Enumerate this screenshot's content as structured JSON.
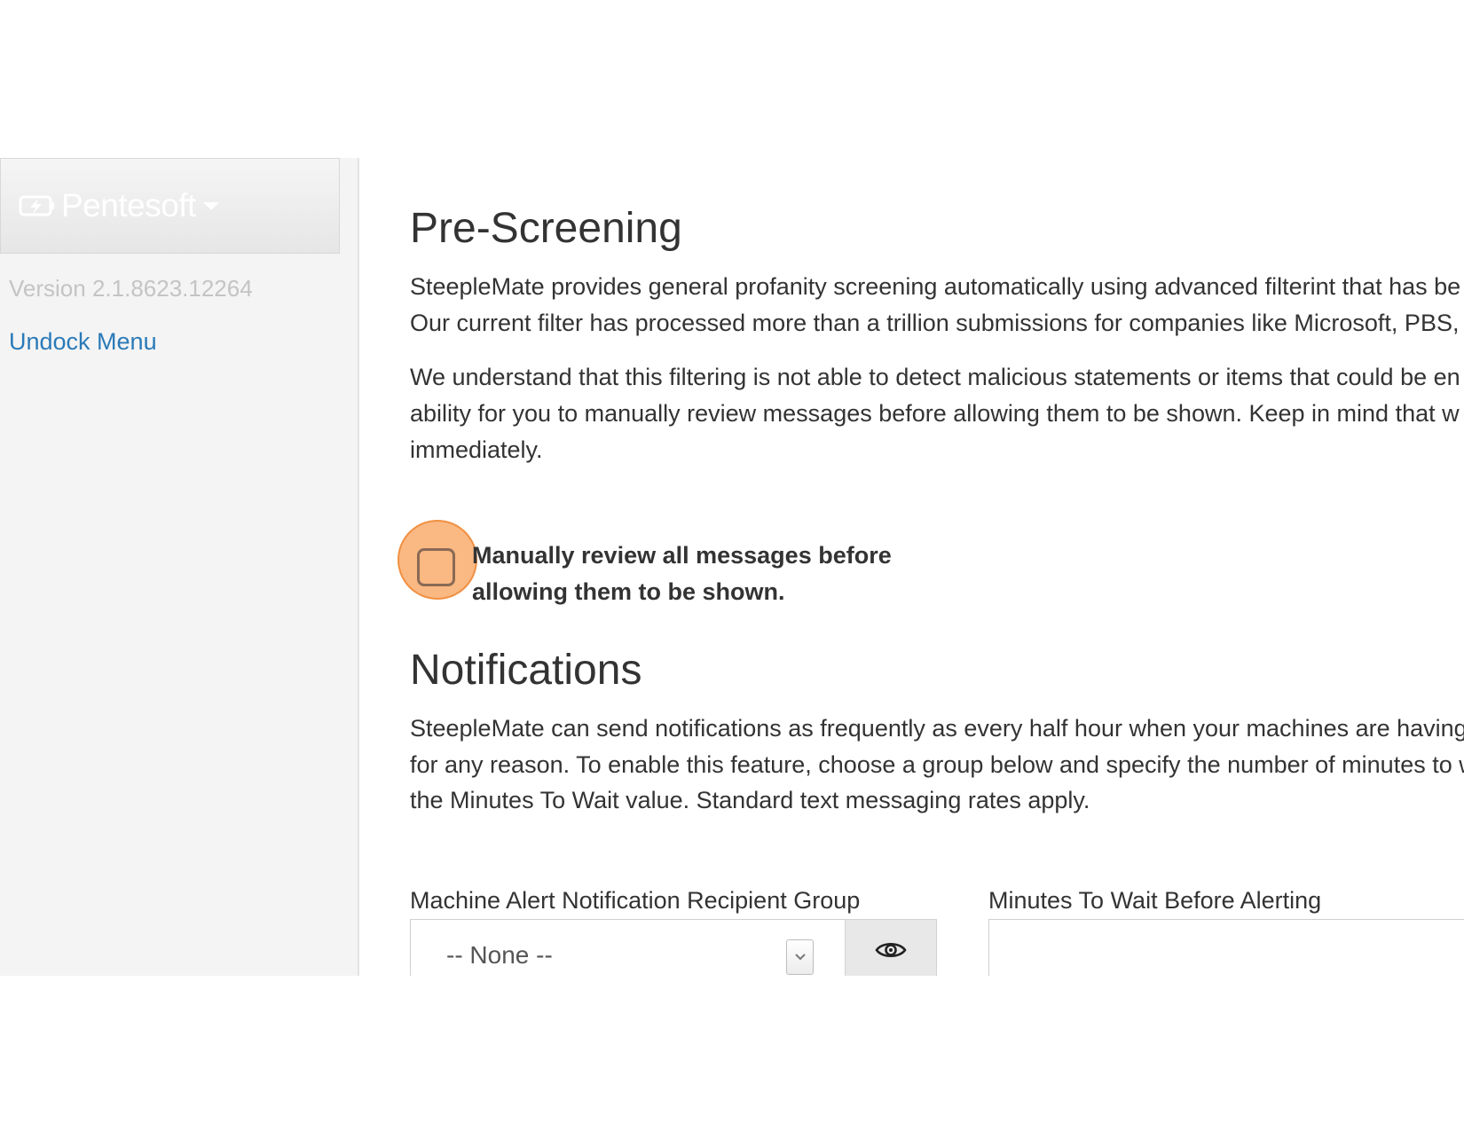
{
  "sidebar": {
    "brand_name": "Pentesoft",
    "version": "Version 2.1.8623.12264",
    "undock_label": "Undock Menu"
  },
  "prescreening": {
    "title": "Pre-Screening",
    "p1_line1": "SteepleMate provides general profanity screening automatically using advanced filterint that has be",
    "p1_line2": "Our current filter has processed more than a trillion submissions for companies like Microsoft, PBS, I",
    "p2_line1": "We understand that this filtering is not able to detect malicious statements or items that could be en",
    "p2_line2": "ability for you to manually review messages before allowing them to be shown. Keep in mind that w",
    "p2_line3": "immediately.",
    "checkbox_line1": "Manually review all messages before",
    "checkbox_line2": "allowing them to be shown.",
    "checkbox_checked": false
  },
  "notifications": {
    "title": "Notifications",
    "p_line1": "SteepleMate can send notifications as frequently as every half hour when your machines are having",
    "p_line2": "for any reason. To enable this feature, choose a group below and specify the number of minutes to w",
    "p_line3": "the Minutes To Wait value. Standard text messaging rates apply.",
    "group_label": "Machine Alert Notification Recipient Group",
    "group_selected": "-- None --",
    "minutes_label": "Minutes To Wait Before Alerting",
    "minutes_value": ""
  },
  "colors": {
    "link": "#2a7ab8",
    "highlight": "#f8a05a"
  }
}
